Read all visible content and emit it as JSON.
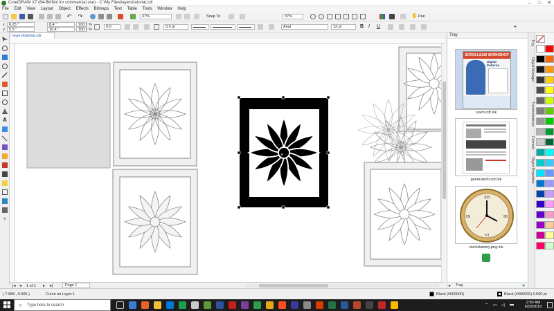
{
  "window": {
    "title": "CorelDRAW X7 (64-Bit/Not for commercial use) - C:\\My Files\\layersttutorial.cdr",
    "minimize": "–",
    "maximize": "□",
    "close": "✕"
  },
  "menu": {
    "items": [
      "File",
      "Edit",
      "View",
      "Layout",
      "Object",
      "Effects",
      "Bitmaps",
      "Text",
      "Table",
      "Tools",
      "Window",
      "Help"
    ]
  },
  "standard_toolbar": {
    "zoom_left": "37%",
    "snap_to": "Snap To",
    "zoom_right": "37%",
    "pan_label": "Pan"
  },
  "property_bar": {
    "x": "6.25 \"",
    "y": "5.5 \"",
    "width": "8.4 \"",
    "height": "10.4 \"",
    "scale_w": "100.0",
    "scale_h": "100.0",
    "pct": "%",
    "angle": "0.0",
    "outline": "0.5 pt",
    "font": "Arial",
    "font_size": "13 pt"
  },
  "document": {
    "tab_name": "layersttutorial.cdr"
  },
  "page_nav": {
    "page_count": "1 of 1",
    "page_tab": "Page 1"
  },
  "status": {
    "coords": "( 7.888 , 0.065 )",
    "selection": "Curve on Layer 1",
    "fill": "Black (#000000)",
    "outline_info": "Black (#000000)  0.500 pt"
  },
  "tray": {
    "title": "Tray",
    "items": [
      {
        "caption": "cavm.cdr.lnk",
        "thumb_title": "SCROLLSAW WORKSHOP",
        "thumb_sub": "Digital Patterns"
      },
      {
        "caption": "generalinfo.cdr.lnk"
      },
      {
        "caption": "clockdummy.png.lnk"
      }
    ],
    "footer": "Tray"
  },
  "docker_tabs": [
    "Tray",
    "Object Manager",
    "Transformations",
    "Connect",
    "Object Properties"
  ],
  "palette": {
    "colors": [
      "#ffffff",
      "#000000",
      "#1a1a1a",
      "#333333",
      "#4d4d4d",
      "#666666",
      "#808080",
      "#999999",
      "#b3b3b3",
      "#cccccc",
      "#00a99d",
      "#00cccc",
      "#00e5ff",
      "#0077cc",
      "#0044aa",
      "#3300cc",
      "#6600cc",
      "#9900cc",
      "#cc0099",
      "#ff0066",
      "#ff0000",
      "#ff6600",
      "#ff9900",
      "#ffcc00",
      "#ffff00",
      "#ccff00",
      "#66cc00",
      "#00cc00",
      "#009933",
      "#006633",
      "#00ffff",
      "#33ccff",
      "#6699ff",
      "#9999ff",
      "#cc99ff",
      "#ff99ff",
      "#ff99cc",
      "#ffcc99",
      "#ffff99",
      "#ccffcc"
    ]
  },
  "taskbar": {
    "search_placeholder": "Type here to search",
    "time": "2:50 AM",
    "date": "6/10/2019"
  }
}
